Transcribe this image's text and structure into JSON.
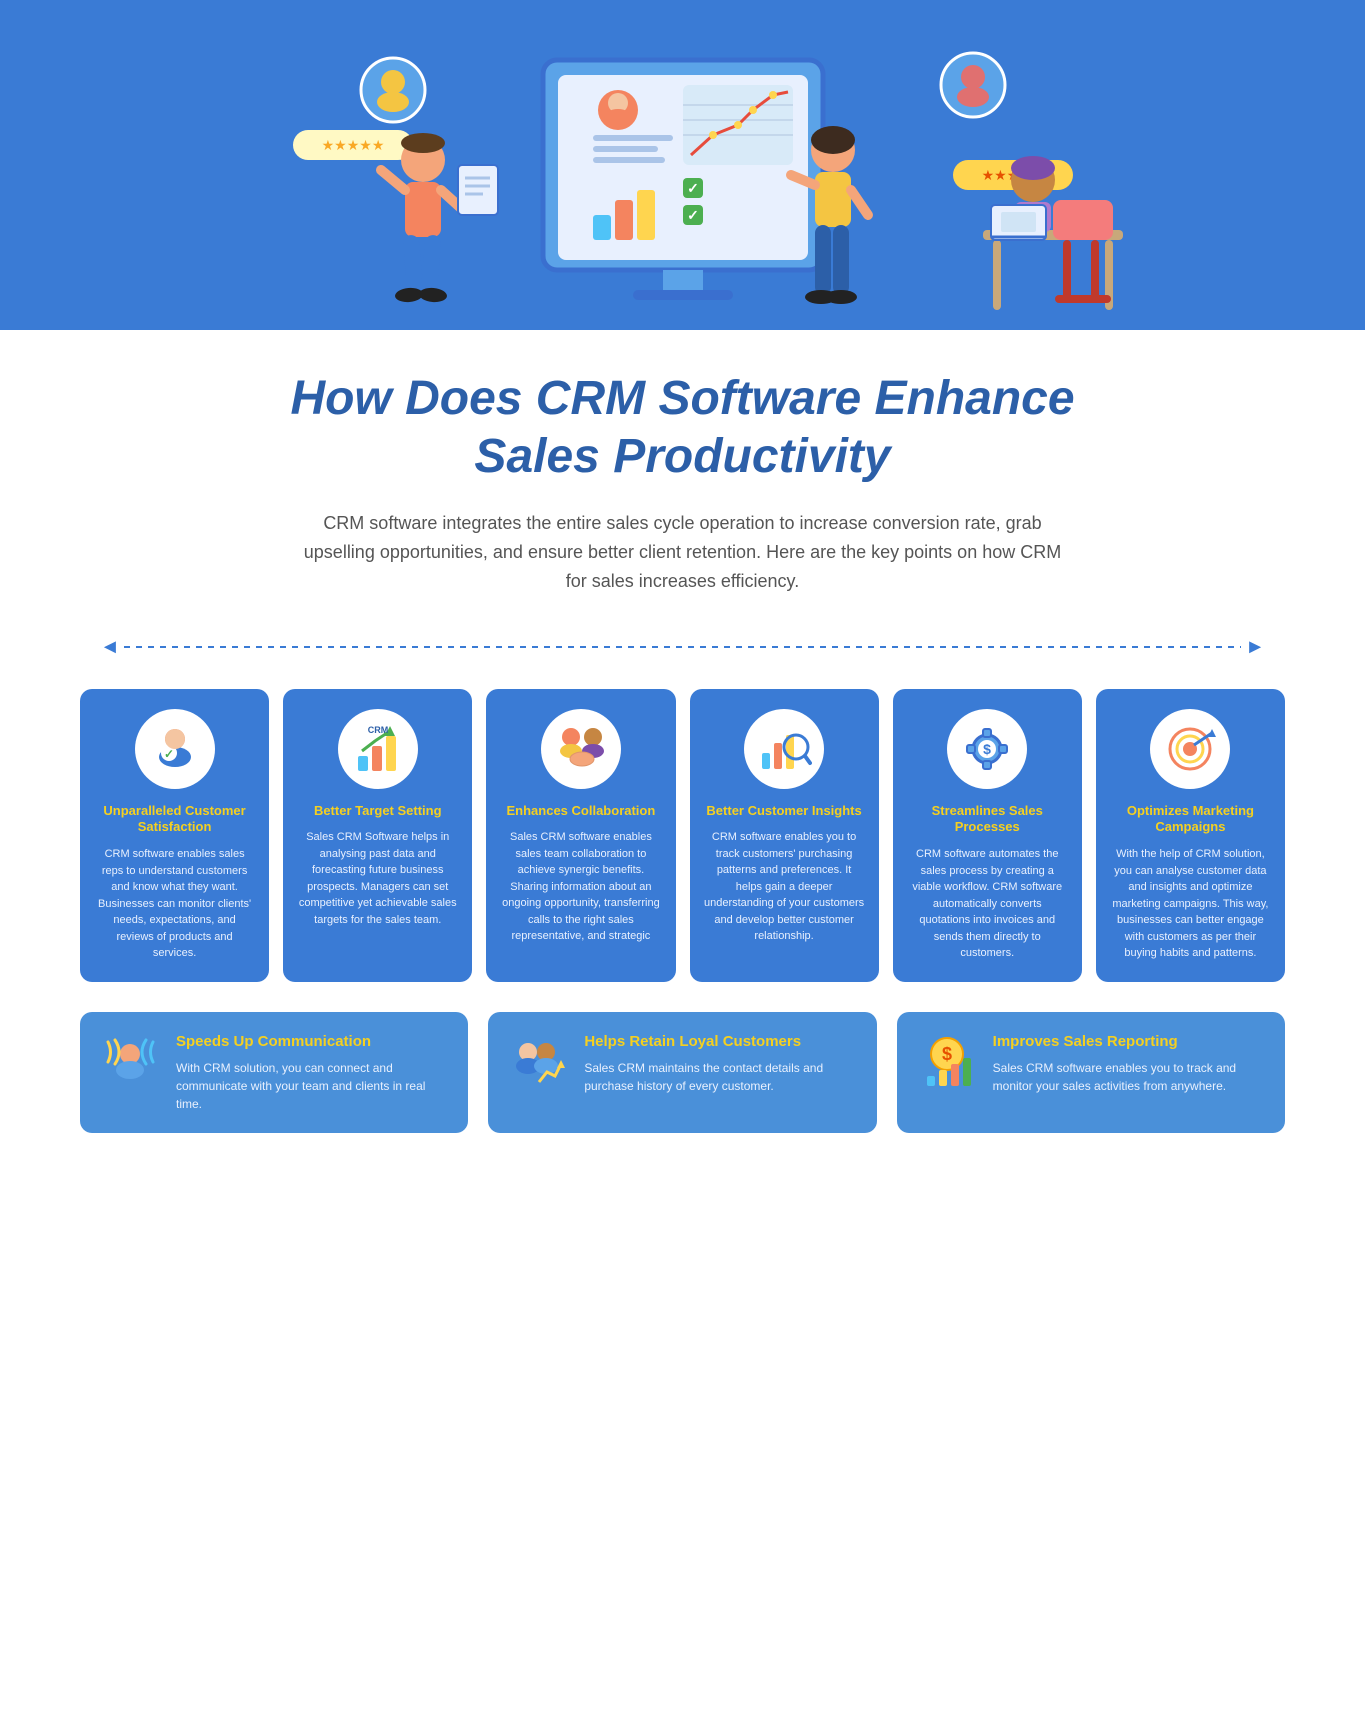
{
  "hero": {
    "bg_color": "#3a7bd5",
    "stars_left": "★★★★★",
    "stars_right": "★★★★★"
  },
  "page": {
    "title_line1": "How Does CRM Software Enhance",
    "title_line2": "Sales Productivity",
    "subtitle": "CRM software integrates the entire sales cycle operation to increase conversion rate, grab upselling opportunities, and ensure better client retention. Here are the key points on how CRM for sales increases efficiency."
  },
  "cards": [
    {
      "title": "Unparalleled Customer Satisfaction",
      "text": "CRM software enables sales reps to understand customers and know what they want. Businesses can monitor clients' needs, expectations, and reviews of products and services.",
      "icon": "😊"
    },
    {
      "title": "Better Target Setting",
      "text": "Sales CRM Software helps in analysing past data and forecasting future business prospects. Managers can set competitive yet achievable sales targets for the sales team.",
      "icon": "📊"
    },
    {
      "title": "Enhances Collaboration",
      "text": "Sales CRM software enables sales team collaboration to achieve synergic benefits. Sharing information about an ongoing opportunity, transferring calls to the right sales representative, and strategic",
      "icon": "🤝"
    },
    {
      "title": "Better Customer Insights",
      "text": "CRM software enables you to track customers' purchasing patterns and preferences. It helps gain a deeper understanding of your customers and develop better customer relationship.",
      "icon": "🔍"
    },
    {
      "title": "Streamlines Sales Processes",
      "text": "CRM software automates the sales process by creating a viable workflow. CRM software automatically converts quotations into invoices and sends them directly to customers.",
      "icon": "⚙️"
    },
    {
      "title": "Optimizes Marketing Campaigns",
      "text": "With the help of CRM solution, you can analyse customer data and insights and optimize marketing campaigns. This way, businesses can better engage with customers as per their buying habits and patterns.",
      "icon": "📢"
    }
  ],
  "bottom_cards": [
    {
      "title": "Speeds Up Communication",
      "text": "With CRM solution, you can connect and communicate with your team and clients in real time.",
      "icon": "📡"
    },
    {
      "title": "Helps Retain Loyal Customers",
      "text": "Sales CRM maintains the contact details and purchase history of every customer.",
      "icon": "👥"
    },
    {
      "title": "Improves Sales Reporting",
      "text": "Sales CRM software enables you to track and monitor your sales activities from anywhere.",
      "icon": "💰"
    }
  ]
}
